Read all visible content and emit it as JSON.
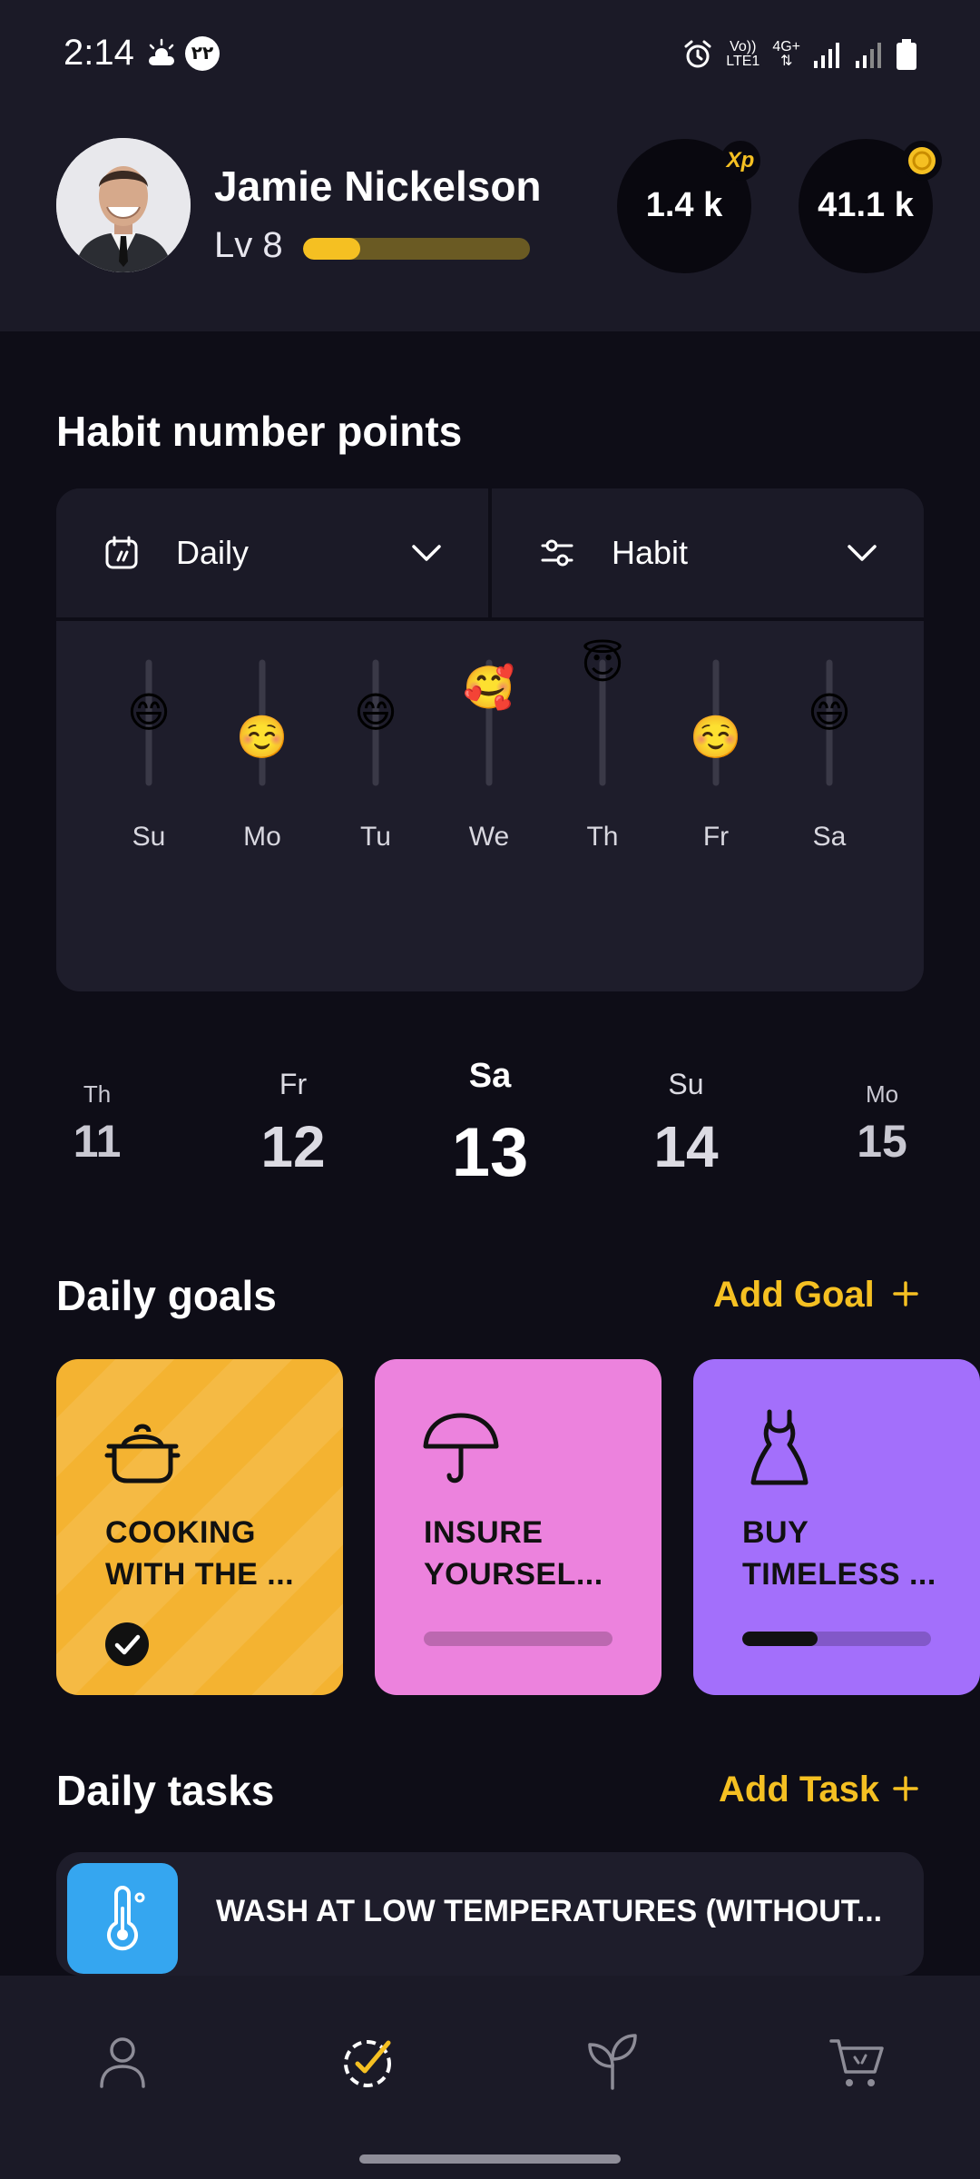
{
  "status_bar": {
    "time": "2:14",
    "badge_text": "۲۲",
    "net_top": "Vo))",
    "net_bottom": "LTE1",
    "net_type": "4G+"
  },
  "profile": {
    "name": "Jamie Nickelson",
    "level_label": "Lv 8",
    "level_progress": 0.25,
    "xp_value": "1.4 k",
    "xp_badge": "Xp",
    "coins_value": "41.1 k"
  },
  "habit_points": {
    "title": "Habit number points",
    "period_filter": "Daily",
    "type_filter": "Habit",
    "chart_data": {
      "type": "scatter",
      "categories": [
        "Su",
        "Mo",
        "Tu",
        "We",
        "Th",
        "Fr",
        "Sa"
      ],
      "values": [
        0.48,
        0.22,
        0.48,
        0.75,
        1.0,
        0.22,
        0.48
      ],
      "markers": [
        "😄",
        "☺️",
        "😄",
        "🥰",
        "😇",
        "☺️",
        "😄"
      ],
      "ylim": [
        0,
        1
      ]
    }
  },
  "date_strip": [
    {
      "day": "Th",
      "date": "11",
      "state": "far"
    },
    {
      "day": "Fr",
      "date": "12",
      "state": "near"
    },
    {
      "day": "Sa",
      "date": "13",
      "state": "selected"
    },
    {
      "day": "Su",
      "date": "14",
      "state": "near"
    },
    {
      "day": "Mo",
      "date": "15",
      "state": "far"
    }
  ],
  "daily_goals": {
    "title": "Daily goals",
    "add_label": "Add Goal",
    "items": [
      {
        "line1": "COOKING",
        "line2": "WITH THE ...",
        "icon": "pot-icon",
        "color": "#f4b331",
        "progress": 1.0,
        "done": true
      },
      {
        "line1": "INSURE",
        "line2": "YOURSEL...",
        "icon": "umbrella-icon",
        "color": "#ec82dd",
        "progress": 0.0,
        "done": false
      },
      {
        "line1": "BUY",
        "line2": "TIMELESS ...",
        "icon": "dress-icon",
        "color": "#a36ffb",
        "progress": 0.4,
        "done": false
      }
    ]
  },
  "daily_tasks": {
    "title": "Daily tasks",
    "add_label": "Add Task",
    "items": [
      {
        "label": "WASH AT LOW TEMPERATURES (WITHOUT...",
        "icon": "thermometer-icon",
        "color": "#35a6f0"
      }
    ]
  },
  "nav": [
    "profile-icon",
    "habits-check-icon",
    "plant-icon",
    "shop-cart-icon"
  ],
  "colors": {
    "accent": "#f5c022",
    "background": "#0e0d17",
    "surface": "#1b1a27",
    "card": "#1e1d2b"
  }
}
